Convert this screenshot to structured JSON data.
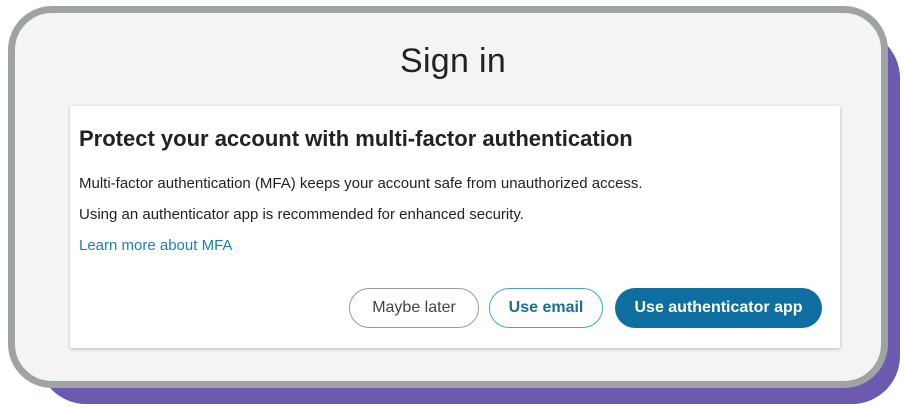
{
  "page": {
    "title": "Sign in"
  },
  "card": {
    "heading": "Protect your account with multi-factor authentication",
    "line1": "Multi-factor authentication (MFA) keeps your account safe from unauthorized access.",
    "line2": "Using an authenticator app is recommended for enhanced security.",
    "learn_more_link": "Learn more about MFA"
  },
  "actions": {
    "maybe_later": "Maybe later",
    "use_email": "Use email",
    "use_authenticator_app": "Use authenticator app"
  },
  "colors": {
    "primary": "#0d6e9f",
    "link": "#1b7fb0",
    "frame_shadow": "#6b5ab0",
    "frame_border": "#9ea3a3"
  }
}
